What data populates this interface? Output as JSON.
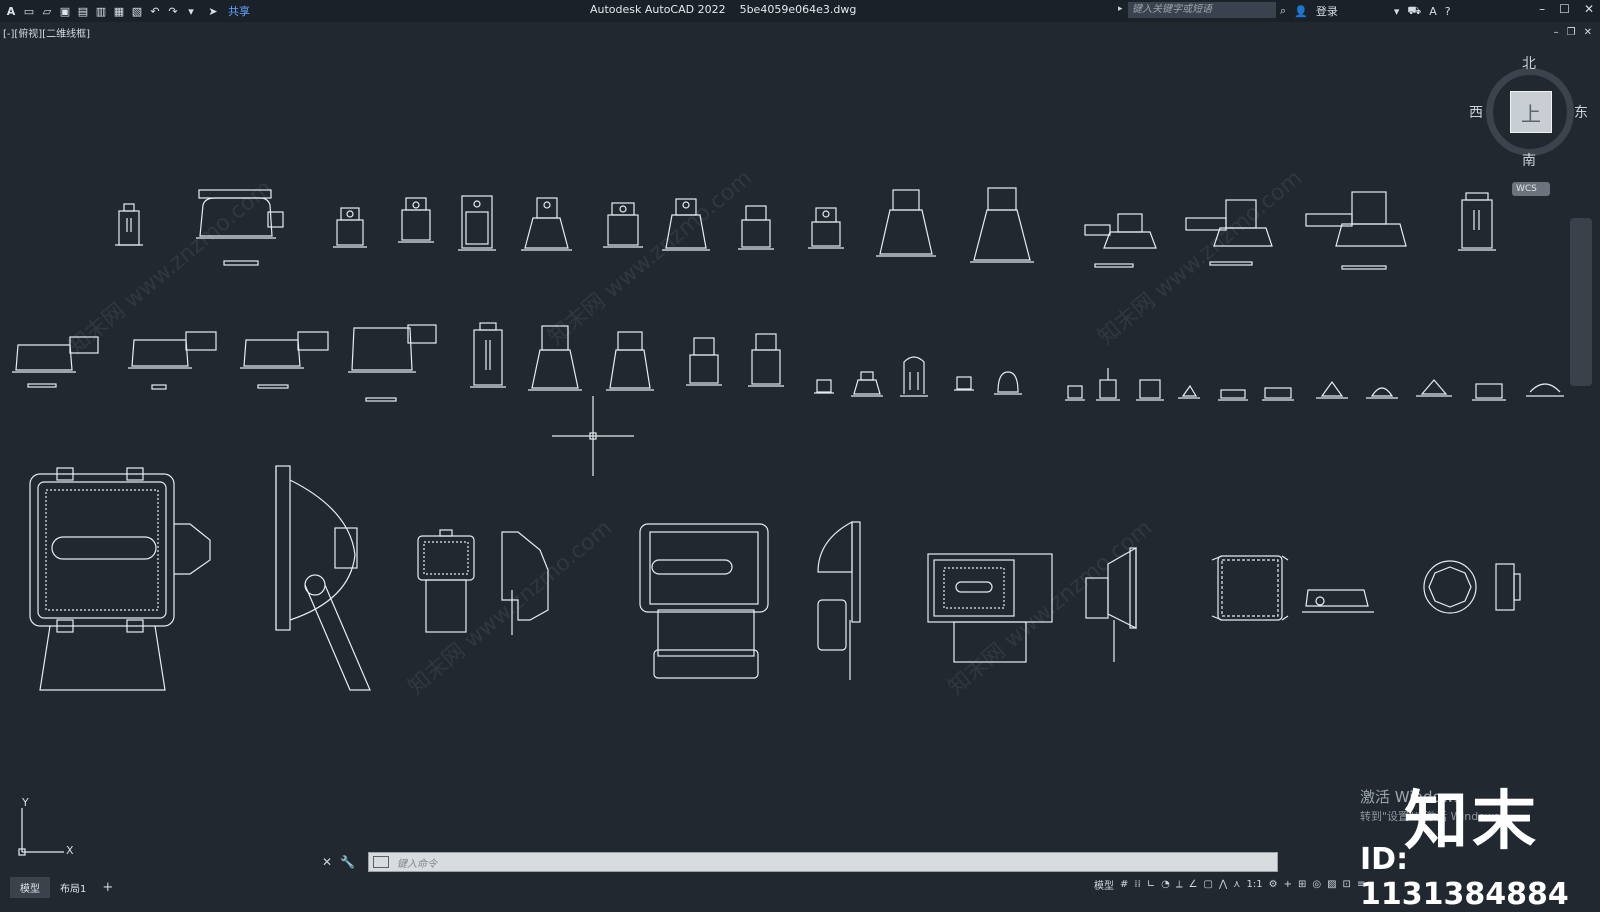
{
  "app": {
    "logo": "A",
    "title": "Autodesk AutoCAD 2022    5be4059e064e3.dwg",
    "share_label": "共享",
    "search_placeholder": "键入关键字或短语",
    "login_label": "登录"
  },
  "viewport": {
    "label": "[-][俯视][二维线框]",
    "viewcube": {
      "north": "北",
      "south": "南",
      "east": "东",
      "west": "西",
      "face": "上"
    },
    "wcs_label": "WCS",
    "ucs_x": "X",
    "ucs_y": "Y"
  },
  "command": {
    "placeholder": "键入命令"
  },
  "tabs": [
    {
      "label": "模型",
      "active": true
    },
    {
      "label": "布局1",
      "active": false
    }
  ],
  "tab_add": "+",
  "statusbar": {
    "model": "模型",
    "scale": "1:1"
  },
  "overlay": {
    "activate_title": "激活 Windows",
    "activate_sub": "转到\"设置\"以激活 Windows。",
    "brand": "知末",
    "brand_id": "ID: 1131384884",
    "watermark": "知末网 www.znzmo.com"
  },
  "colors": {
    "background": "#212830",
    "lines": "#e8ecf0",
    "accent": "#5fa7ff"
  }
}
